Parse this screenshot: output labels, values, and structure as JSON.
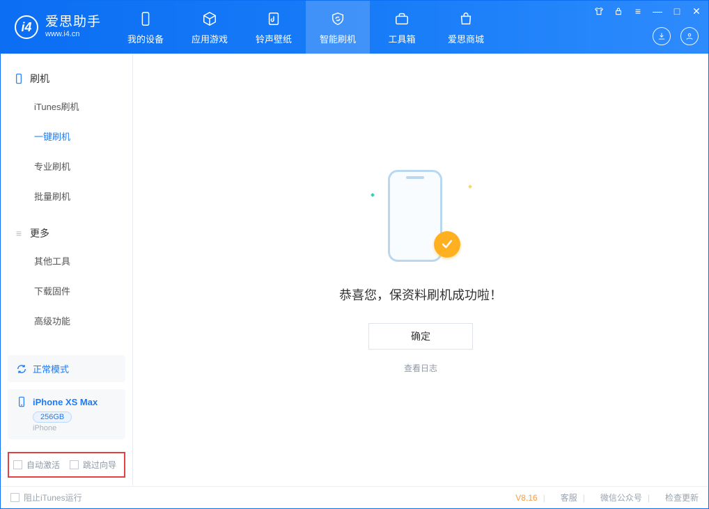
{
  "app": {
    "name_cn": "爱思助手",
    "name_en": "www.i4.cn"
  },
  "tabs": {
    "device": "我的设备",
    "apps": "应用游戏",
    "ringtone": "铃声壁纸",
    "flash": "智能刷机",
    "toolbox": "工具箱",
    "store": "爱思商城"
  },
  "sidebar": {
    "section_flash": "刷机",
    "items_flash": {
      "itunes": "iTunes刷机",
      "oneclick": "一键刷机",
      "pro": "专业刷机",
      "batch": "批量刷机"
    },
    "section_more": "更多",
    "items_more": {
      "other": "其他工具",
      "firmware": "下载固件",
      "advanced": "高级功能"
    }
  },
  "device_panel": {
    "mode": "正常模式",
    "name": "iPhone XS Max",
    "capacity": "256GB",
    "type": "iPhone"
  },
  "bottom_options": {
    "auto_activate": "自动激活",
    "skip_guide": "跳过向导"
  },
  "main": {
    "success_text": "恭喜您，保资料刷机成功啦！",
    "ok_btn": "确定",
    "view_log": "查看日志"
  },
  "footer": {
    "block_itunes": "阻止iTunes运行",
    "version": "V8.16",
    "support": "客服",
    "wechat": "微信公众号",
    "check_update": "检查更新"
  }
}
